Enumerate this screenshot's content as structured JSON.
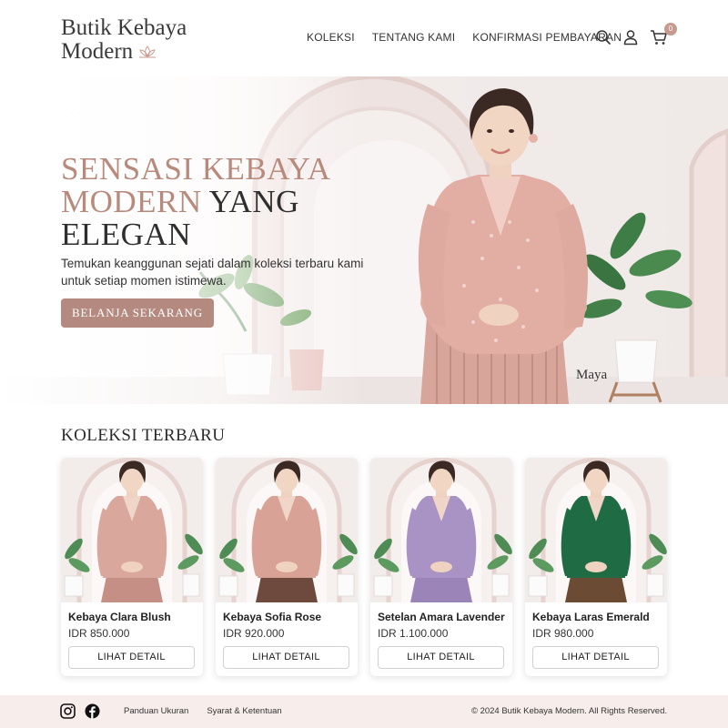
{
  "header": {
    "logo_line1": "Butik Kebaya",
    "logo_line2": "Modern",
    "nav": [
      "KOLEKSI",
      "TENTANG KAMI",
      "KONFIRMASI PEMBAYARAN"
    ],
    "cart_count": "0"
  },
  "hero": {
    "title_part1": "SENSASI KEBAYA",
    "title_part2": "MODERN",
    "title_part3": "YANG",
    "title_part4": "ELEGAN",
    "subtitle": "Temukan keanggunan sejati dalam koleksi terbaru kami untuk setiap momen istimewa.",
    "cta_label": "BELANJA SEKARANG",
    "model_name": "Maya"
  },
  "collection": {
    "title": "KOLEKSI TERBARU",
    "button_label": "LIHAT DETAIL",
    "products": [
      {
        "name": "Kebaya Clara Blush",
        "price": "IDR 850.000",
        "top_color": "#d9a79c",
        "skirt_color": "#c58f85"
      },
      {
        "name": "Kebaya Sofia Rose",
        "price": "IDR 920.000",
        "top_color": "#d8a296",
        "skirt_color": "#6e4a3e"
      },
      {
        "name": "Setelan Amara Lavender",
        "price": "IDR 1.100.000",
        "top_color": "#a993c4",
        "skirt_color": "#9b85b8"
      },
      {
        "name": "Kebaya Laras Emerald",
        "price": "IDR 980.000",
        "top_color": "#1f6b43",
        "skirt_color": "#6b4b33"
      }
    ]
  },
  "footer": {
    "links": [
      "Panduan Ukuran",
      "Syarat & Ketentuan"
    ],
    "copyright": "© 2024 Butik Kebaya Modern. All Rights Reserved."
  },
  "colors": {
    "accent": "#b48a80",
    "footer_bg": "#f7eeec"
  }
}
